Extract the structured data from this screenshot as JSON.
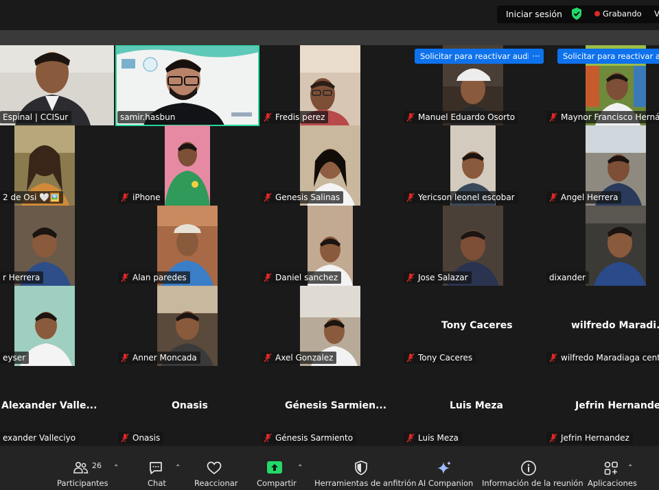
{
  "topbar": {
    "signin": "Iniciar sesión",
    "recording": "Grabando",
    "view": "V"
  },
  "tiles": [
    {
      "name": "Espinal | CCISur",
      "muted": false
    },
    {
      "name": "samir.hasbun",
      "muted": false
    },
    {
      "name": "Fredis perez",
      "muted": true
    },
    {
      "name": "Manuel Eduardo Osorto",
      "muted": true
    },
    {
      "name": "Maynor Francisco Herná",
      "muted": true
    },
    {
      "name": "2 de Osi 🤍🖼️",
      "muted": false
    },
    {
      "name": "iPhone",
      "muted": true
    },
    {
      "name": "Genesis Salinas",
      "muted": true
    },
    {
      "name": "Yericson leonel escobar",
      "muted": true
    },
    {
      "name": "Angel Herrera",
      "muted": true
    },
    {
      "name": "r Herrera",
      "muted": false
    },
    {
      "name": "Alan paredes",
      "muted": true
    },
    {
      "name": "Daniel sanchez",
      "muted": true
    },
    {
      "name": "Jose Salazar",
      "muted": true
    },
    {
      "name": "dixander",
      "muted": false
    },
    {
      "name": "eyser",
      "muted": false
    },
    {
      "name": "Anner Moncada",
      "muted": true
    },
    {
      "name": "Axel Gonzalez",
      "muted": true
    },
    {
      "name": "Tony Caceres",
      "big": "Tony Caceres",
      "muted": true
    },
    {
      "name": "wilfredo Maradiaga cent",
      "big": "wilfredo  Maradi...",
      "muted": true
    },
    {
      "name": "exander Valleciyo",
      "big": "Alexander  Valle...",
      "muted": false
    },
    {
      "name": "Onasis",
      "big": "Onasis",
      "muted": true
    },
    {
      "name": "Génesis Sarmiento",
      "big": "Génesis  Sarmien...",
      "muted": true
    },
    {
      "name": "Luis Meza",
      "big": "Luis Meza",
      "muted": true
    },
    {
      "name": "Jefrin Hernandez",
      "big": "Jefrin Hernandez",
      "muted": true
    }
  ],
  "reactivate": {
    "label": "Solicitar para reactivar audio",
    "more": "···"
  },
  "toolbar": {
    "participants_label": "Participantes",
    "participants_count": "26",
    "chat_label": "Chat",
    "react_label": "Reaccionar",
    "share_label": "Compartir",
    "host_tools_label": "Herramientas de anfitrión",
    "ai_label": "AI Companion",
    "info_label": "Información de la reunión",
    "apps_label": "Aplicaciones"
  },
  "colors": {
    "accent_blue": "#0e72ed",
    "share_green": "#23d96a",
    "active_speaker": "#23d99a",
    "muted_red": "#e02828"
  }
}
